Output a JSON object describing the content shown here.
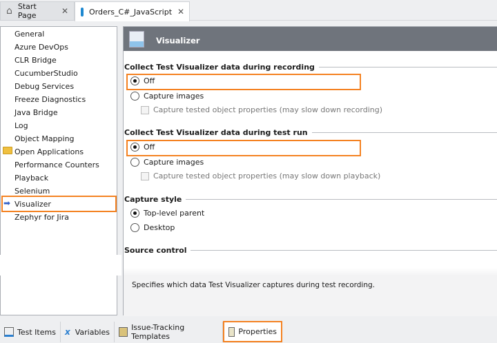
{
  "tabs": [
    {
      "label": "Start Page",
      "icon": "home-icon"
    },
    {
      "label": "Orders_C#_JavaScript",
      "icon": "project-icon"
    }
  ],
  "sidebar": {
    "items": [
      {
        "label": "General"
      },
      {
        "label": "Azure DevOps"
      },
      {
        "label": "CLR Bridge"
      },
      {
        "label": "CucumberStudio"
      },
      {
        "label": "Debug Services"
      },
      {
        "label": "Freeze Diagnostics"
      },
      {
        "label": "Java Bridge"
      },
      {
        "label": "Log"
      },
      {
        "label": "Object Mapping"
      },
      {
        "label": "Open Applications",
        "icon": "folder-icon"
      },
      {
        "label": "Performance Counters"
      },
      {
        "label": "Playback"
      },
      {
        "label": "Selenium"
      },
      {
        "label": "Visualizer",
        "selected": true,
        "icon": "arrow-right-icon"
      },
      {
        "label": "Zephyr for Jira"
      }
    ]
  },
  "panel": {
    "title": "Visualizer",
    "recording": {
      "title": "Collect Test Visualizer data during recording",
      "off": "Off",
      "capture": "Capture images",
      "props": "Capture tested object properties (may slow down recording)",
      "selected": "Off"
    },
    "run": {
      "title": "Collect Test Visualizer data during test run",
      "off": "Off",
      "capture": "Capture images",
      "props": "Capture tested object properties (may slow down playback)",
      "selected": "Off"
    },
    "style": {
      "title": "Capture style",
      "top": "Top-level parent",
      "desktop": "Desktop",
      "selected": "Top-level parent"
    },
    "source": {
      "title": "Source control"
    },
    "description": "Specifies which data Test Visualizer captures during test recording."
  },
  "bottom_tabs": [
    {
      "label": "Test Items"
    },
    {
      "label": "Variables"
    },
    {
      "label": "Issue-Tracking Templates"
    },
    {
      "label": "Properties",
      "active": true
    }
  ],
  "colors": {
    "highlight": "#f48120",
    "header": "#6f747c"
  }
}
